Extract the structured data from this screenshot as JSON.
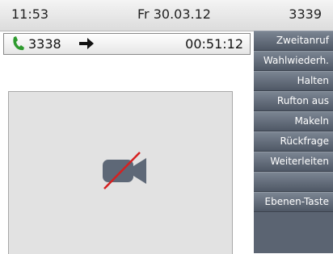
{
  "status": {
    "time": "11:53",
    "date": "Fr 30.03.12",
    "extension": "3339"
  },
  "call": {
    "number": "3338",
    "duration": "00:51:12",
    "phone_icon": "handset-icon",
    "arrow_icon": "arrow-right-icon"
  },
  "video": {
    "icon": "video-off-icon"
  },
  "menu": [
    {
      "label": "Zweitanruf"
    },
    {
      "label": "Wahlwiederh."
    },
    {
      "label": "Halten"
    },
    {
      "label": "Rufton aus"
    },
    {
      "label": "Makeln"
    },
    {
      "label": "Rückfrage"
    },
    {
      "label": "Weiterleiten"
    },
    {
      "label": ""
    },
    {
      "label": "Ebenen-Taste"
    }
  ],
  "colors": {
    "accent_green": "#2e9a2e",
    "menu_bg": "#5b6472",
    "video_bg": "#e2e2e2"
  }
}
